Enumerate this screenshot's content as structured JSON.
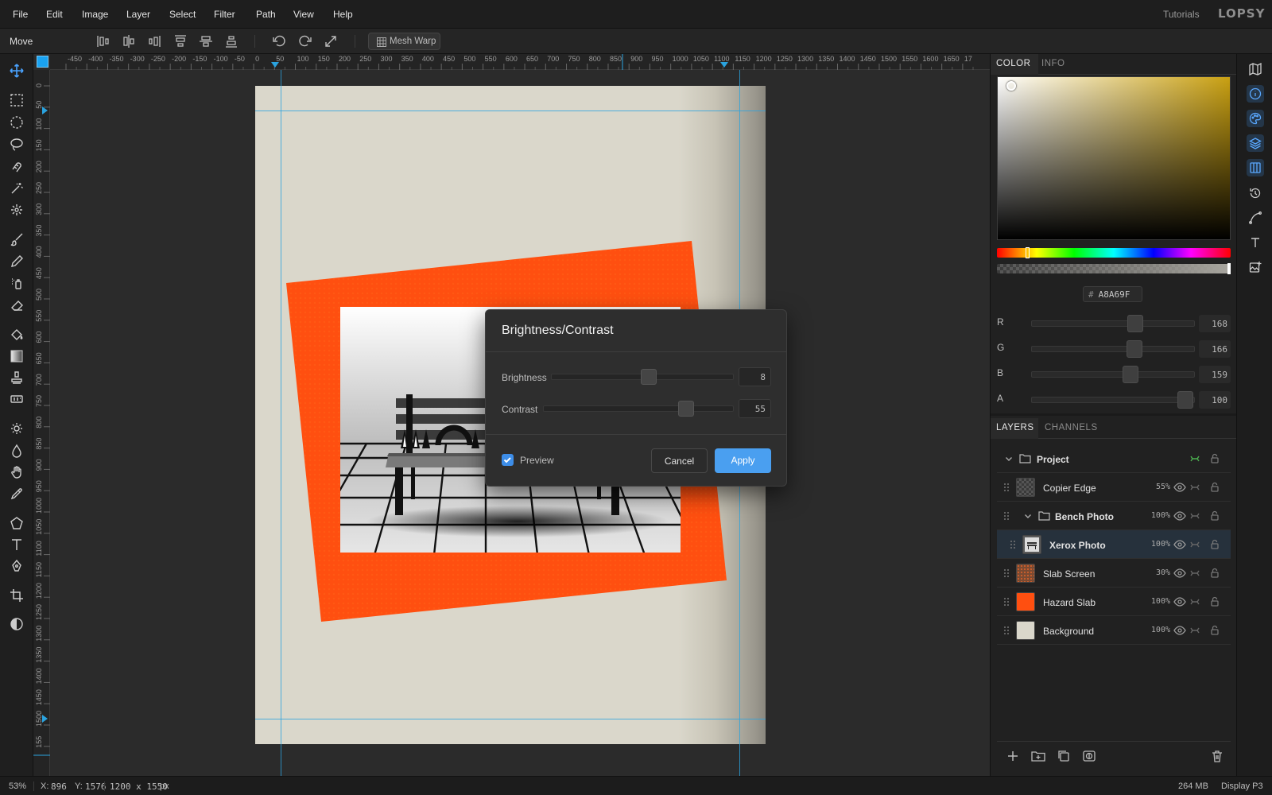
{
  "menu": [
    "File",
    "Edit",
    "Image",
    "Layer",
    "Select",
    "Filter",
    "Path",
    "View",
    "Help"
  ],
  "header": {
    "tutorials": "Tutorials",
    "logo": "LOPSY"
  },
  "options": {
    "tool_name": "Move",
    "mesh_warp": "Mesh Warp"
  },
  "rulers": {
    "h_ticks": [
      "-450",
      "-400",
      "-350",
      "-300",
      "-250",
      "-200",
      "-150",
      "-100",
      "-50",
      "0",
      "50",
      "100",
      "150",
      "200",
      "250",
      "300",
      "350",
      "400",
      "450",
      "500",
      "550",
      "600",
      "650",
      "700",
      "750",
      "800",
      "850",
      "900",
      "950",
      "1000",
      "1050",
      "1100",
      "1150",
      "1200",
      "1250",
      "1300",
      "1350",
      "1400",
      "1450",
      "1500",
      "1550",
      "1600",
      "1650",
      "17"
    ],
    "v_ticks": [
      "0",
      "50",
      "100",
      "150",
      "200",
      "250",
      "300",
      "350",
      "400",
      "450",
      "500",
      "550",
      "600",
      "650",
      "700",
      "750",
      "800",
      "850",
      "900",
      "950",
      "1000",
      "1050",
      "1100",
      "1150",
      "1200",
      "1250",
      "1300",
      "1350",
      "1400",
      "1450",
      "1500",
      "155"
    ]
  },
  "dialog": {
    "title": "Brightness/Contrast",
    "brightness_label": "Brightness",
    "brightness_value": "8",
    "contrast_label": "Contrast",
    "contrast_value": "55",
    "preview_label": "Preview",
    "preview_checked": true,
    "cancel": "Cancel",
    "apply": "Apply"
  },
  "color_panel": {
    "tabs": [
      "COLOR",
      "INFO"
    ],
    "hex_prefix": "#",
    "hex": "A8A69F",
    "channels": [
      {
        "label": "R",
        "value": "168",
        "fraction": 0.659
      },
      {
        "label": "G",
        "value": "166",
        "fraction": 0.651
      },
      {
        "label": "B",
        "value": "159",
        "fraction": 0.624
      },
      {
        "label": "A",
        "value": "100",
        "fraction": 1.0
      }
    ],
    "hue_fraction": 0.125,
    "base_hue_color": "#c9a012"
  },
  "layers_panel": {
    "tabs": [
      "LAYERS",
      "CHANNELS"
    ],
    "layers": [
      {
        "name": "Project",
        "opacity": "",
        "type": "group",
        "selected": false
      },
      {
        "name": "Copier Edge",
        "opacity": "55%",
        "type": "layer",
        "selected": false
      },
      {
        "name": "Bench Photo",
        "opacity": "100%",
        "type": "group",
        "selected": false
      },
      {
        "name": "Xerox Photo",
        "opacity": "100%",
        "type": "layer",
        "selected": true
      },
      {
        "name": "Slab Screen",
        "opacity": "30%",
        "type": "layer",
        "selected": false
      },
      {
        "name": "Hazard Slab",
        "opacity": "100%",
        "type": "layer",
        "selected": false
      },
      {
        "name": "Background",
        "opacity": "100%",
        "type": "layer",
        "selected": false
      }
    ]
  },
  "status": {
    "zoom": "53%",
    "x_label": "X:",
    "x": "896",
    "y_label": "Y:",
    "y": "1576",
    "doc_size": "1200 x 1550",
    "doc_unit": "px",
    "memory": "264 MB",
    "profile": "Display P3"
  },
  "colors": {
    "accent": "#4a9ff0",
    "guide": "#2aa3df",
    "hazard": "#ff4f10",
    "paper": "#dad7cb"
  }
}
